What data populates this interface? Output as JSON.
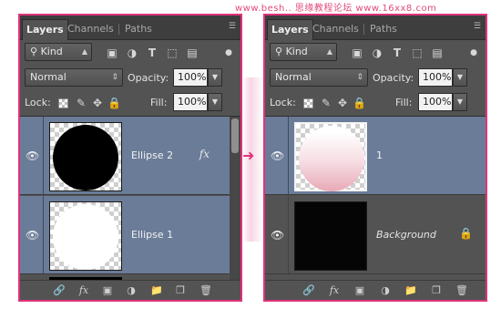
{
  "watermark": "www.besh.. 思缘教程论坛 www.16xx8.com",
  "colors": {
    "accent": "#e0337a",
    "panel_bg": "#535353",
    "selected_layer": "#6b7c98"
  },
  "left_panel": {
    "tabs": [
      {
        "label": "Layers",
        "active": true
      },
      {
        "label": "Channels",
        "active": false
      },
      {
        "label": "Paths",
        "active": false
      }
    ],
    "filter": {
      "label": "Kind"
    },
    "blend_mode": "Normal",
    "opacity_label": "Opacity:",
    "opacity_value": "100%",
    "lock_label": "Lock:",
    "fill_label": "Fill:",
    "fill_value": "100%",
    "layers": [
      {
        "name": "Ellipse 2",
        "thumb": "black-circle",
        "effects": "fx",
        "selected": true
      },
      {
        "name": "Ellipse 1",
        "thumb": "white-circle",
        "selected": true
      }
    ]
  },
  "right_panel": {
    "tabs": [
      {
        "label": "Layers",
        "active": true
      },
      {
        "label": "Channels",
        "active": false
      },
      {
        "label": "Paths",
        "active": false
      }
    ],
    "filter": {
      "label": "Kind"
    },
    "blend_mode": "Normal",
    "opacity_label": "Opacity:",
    "opacity_value": "100%",
    "lock_label": "Lock:",
    "fill_label": "Fill:",
    "fill_value": "100%",
    "layers": [
      {
        "name": "1",
        "thumb": "pink-gradient-circle",
        "selected": true
      },
      {
        "name": "Background",
        "thumb": "black",
        "locked": true,
        "selected": false
      }
    ]
  },
  "footer_icons": [
    "link-icon",
    "fx-icon",
    "mask-icon",
    "adjustment-icon",
    "folder-icon",
    "new-layer-icon",
    "trash-icon"
  ],
  "footer_fx_label": "fx"
}
